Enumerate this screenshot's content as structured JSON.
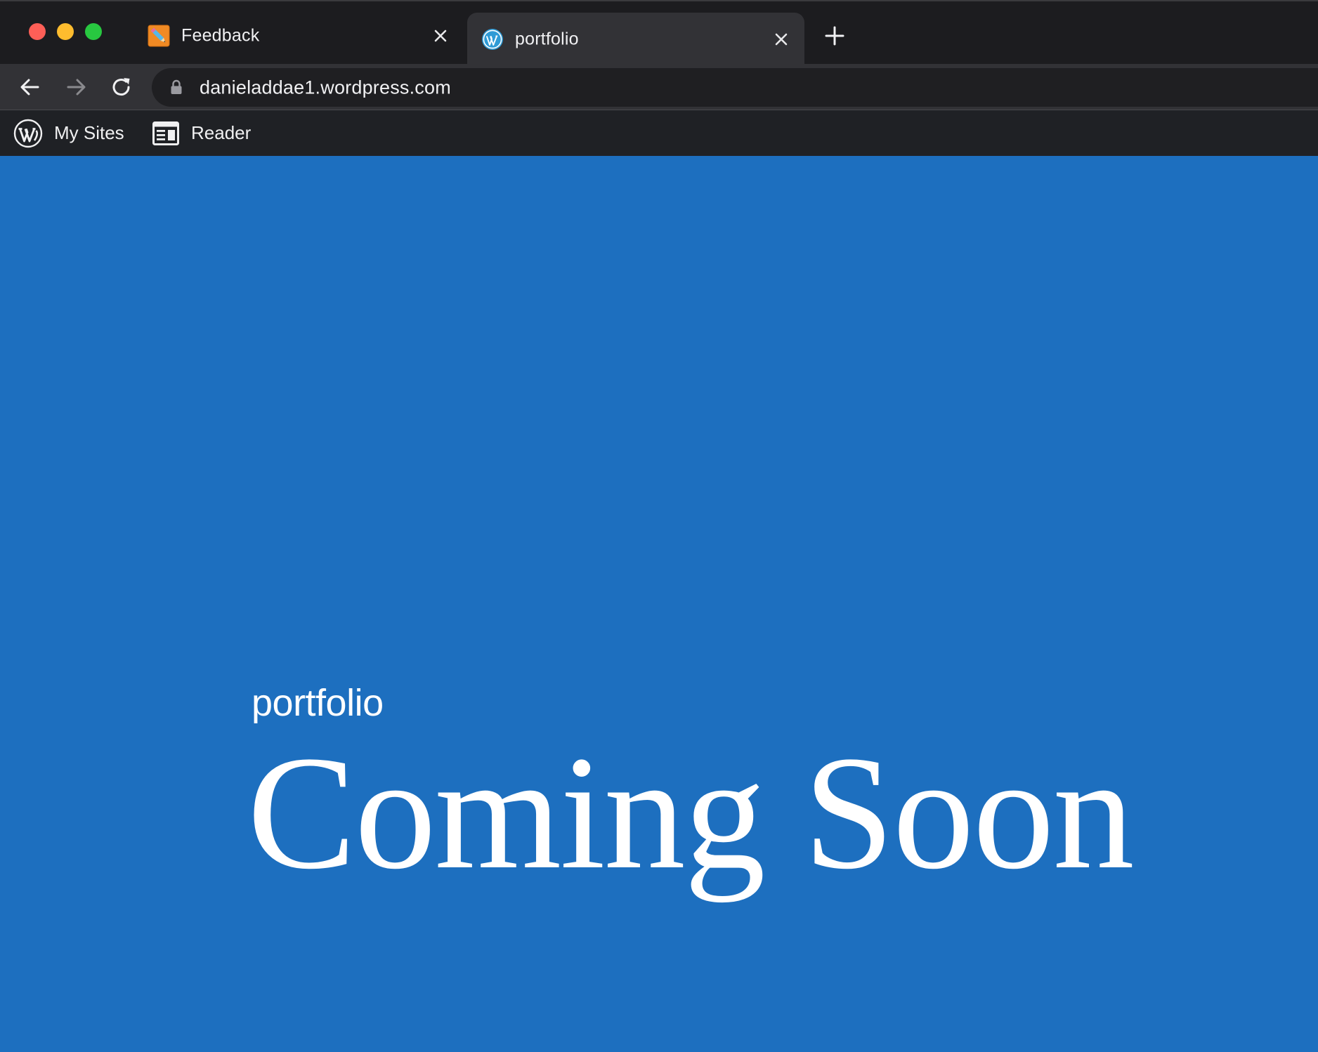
{
  "browser": {
    "tabs": [
      {
        "title": "Feedback",
        "icon": "pencil-notepad-icon",
        "active": false
      },
      {
        "title": "portfolio",
        "icon": "wordpress-logo-icon",
        "active": true
      }
    ],
    "address": "danieladdae1.wordpress.com"
  },
  "admin_bar": {
    "my_sites_label": "My Sites",
    "reader_label": "Reader"
  },
  "page": {
    "site_name": "portfolio",
    "headline": "Coming Soon"
  },
  "colors": {
    "page_background": "#1d6fbf",
    "tabstrip": "#1c1c1f",
    "toolbar": "#323236",
    "admin_bar": "#1f2125",
    "traffic_red": "#fe5f57",
    "traffic_yellow": "#febc2e",
    "traffic_green": "#28c840"
  }
}
